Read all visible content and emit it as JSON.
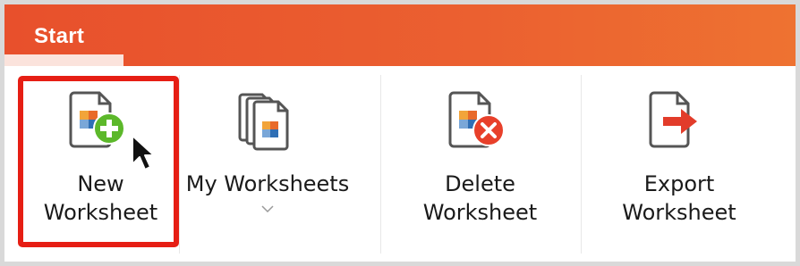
{
  "header": {
    "tab_label": "Start"
  },
  "ribbon": {
    "items": [
      {
        "label": "New\nWorksheet",
        "icon": "new-worksheet-icon"
      },
      {
        "label": "My Worksheets",
        "icon": "my-worksheets-icon",
        "has_dropdown": true
      },
      {
        "label": "Delete\nWorksheet",
        "icon": "delete-worksheet-icon"
      },
      {
        "label": "Export\nWorksheet",
        "icon": "export-worksheet-icon"
      }
    ]
  },
  "colors": {
    "header_start": "#e8502c",
    "header_end": "#ee7231",
    "highlight": "#e61e14",
    "add_badge": "#5cb82a",
    "delete_badge": "#e8402a",
    "export_arrow": "#e23c2a"
  }
}
